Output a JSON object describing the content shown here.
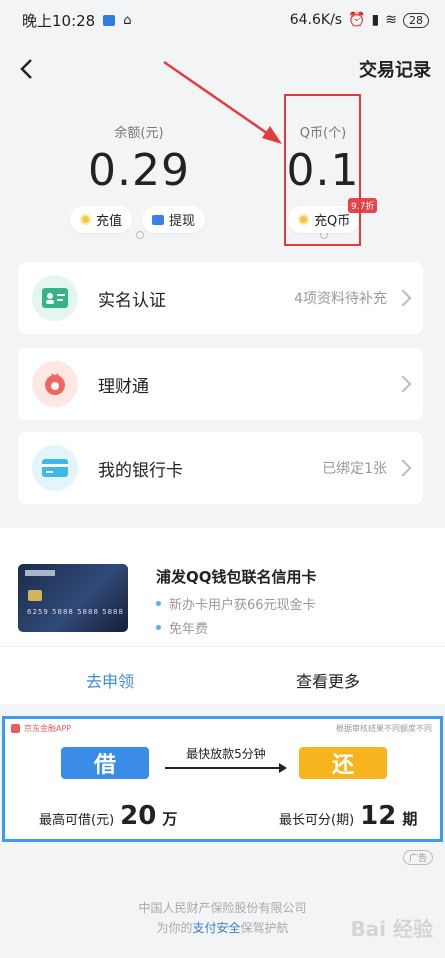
{
  "status": {
    "time": "晚上10:28",
    "speed": "64.6K/s",
    "battery": "28"
  },
  "nav": {
    "title": "交易记录"
  },
  "balance": {
    "label": "余额(元)",
    "value": "0.29",
    "recharge": "充值",
    "withdraw": "提现"
  },
  "qcoin": {
    "label": "Q币(个)",
    "value": "0.1",
    "button": "充Q币",
    "badge": "9.7折"
  },
  "list": [
    {
      "title": "实名认证",
      "right": "4项资料待补充"
    },
    {
      "title": "理财通",
      "right": ""
    },
    {
      "title": "我的银行卡",
      "right": "已绑定1张"
    }
  ],
  "promo": {
    "title": "浦发QQ钱包联名信用卡",
    "items": [
      "新办卡用户获66元现金卡",
      "免年费"
    ],
    "apply": "去申领",
    "more": "查看更多",
    "card_number": "6259 5888 5888 5888"
  },
  "ad": {
    "brand": "京东金融APP",
    "disclaimer": "根据审核结果不同额度不同",
    "borrow": "借",
    "repay": "还",
    "fast": "最快放款5分钟",
    "max_label": "最高可借(元)",
    "max_value": "20",
    "max_unit": "万",
    "term_label": "最长可分(期)",
    "term_value": "12",
    "term_unit": "期",
    "tag": "广告"
  },
  "footer": {
    "line1": "中国人民财产保险股份有限公司",
    "line2_pre": "为你的",
    "line2_blue": "支付安全",
    "line2_post": "保驾护航"
  },
  "colors": {
    "accent_blue": "#3b8ce6",
    "ad_orange": "#f6b51e",
    "highlight_red": "#e23b3b"
  }
}
